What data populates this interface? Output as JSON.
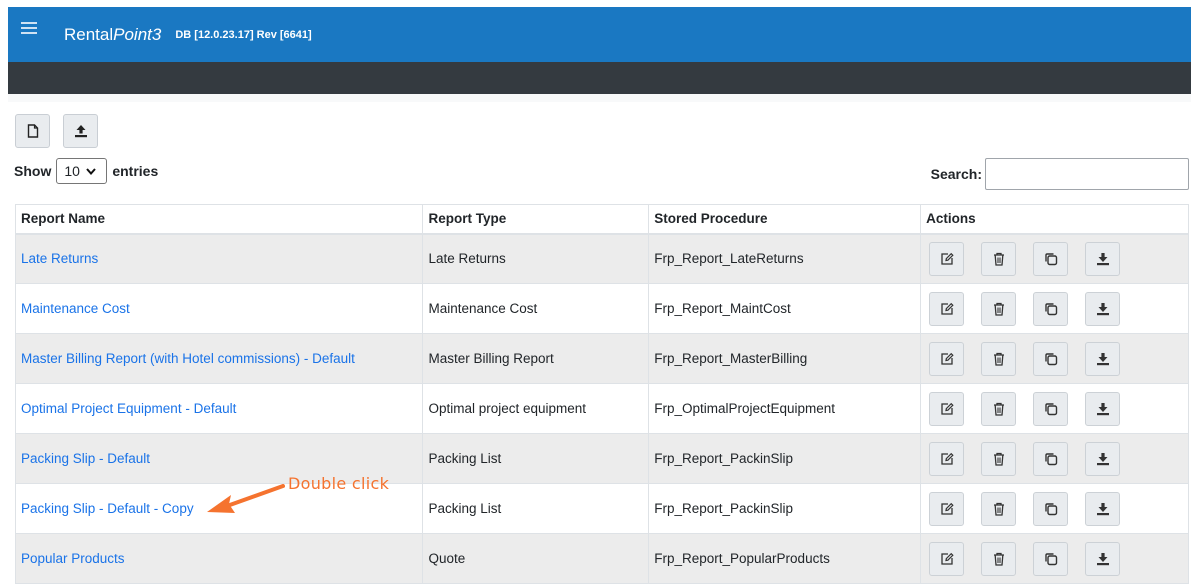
{
  "header": {
    "app_name_plain": "Rental",
    "app_name_italic": "Point3",
    "version": "DB [12.0.23.17]  Rev [6641]"
  },
  "toolbar": {
    "new_icon": "document-icon",
    "upload_icon": "upload-icon"
  },
  "controls": {
    "show_label": "Show",
    "entries_value": "10",
    "entries_label": "entries",
    "search_label": "Search:",
    "search_value": ""
  },
  "table": {
    "headers": [
      "Report Name",
      "Report Type",
      "Stored Procedure",
      "Actions"
    ],
    "rows": [
      {
        "name": "Late Returns",
        "type": "Late Returns",
        "proc": "Frp_Report_LateReturns"
      },
      {
        "name": "Maintenance Cost",
        "type": "Maintenance Cost",
        "proc": "Frp_Report_MaintCost"
      },
      {
        "name": "Master Billing Report (with Hotel commissions) - Default",
        "type": "Master Billing Report",
        "proc": "Frp_Report_MasterBilling"
      },
      {
        "name": "Optimal Project Equipment - Default",
        "type": "Optimal project equipment",
        "proc": "Frp_OptimalProjectEquipment"
      },
      {
        "name": "Packing Slip - Default",
        "type": "Packing List",
        "proc": "Frp_Report_PackinSlip"
      },
      {
        "name": "Packing Slip - Default - Copy",
        "type": "Packing List",
        "proc": "Frp_Report_PackinSlip"
      },
      {
        "name": "Popular Products",
        "type": "Quote",
        "proc": "Frp_Report_PopularProducts"
      }
    ],
    "action_icons": [
      "edit-icon",
      "trash-icon",
      "copy-icon",
      "download-icon"
    ]
  },
  "annotation": {
    "text": "Double click",
    "color": "#f5732f"
  },
  "colors": {
    "header_bg": "#1a78c2",
    "subbar_bg": "#343a40",
    "link": "#1a73e8",
    "striped_row": "#ececec"
  }
}
